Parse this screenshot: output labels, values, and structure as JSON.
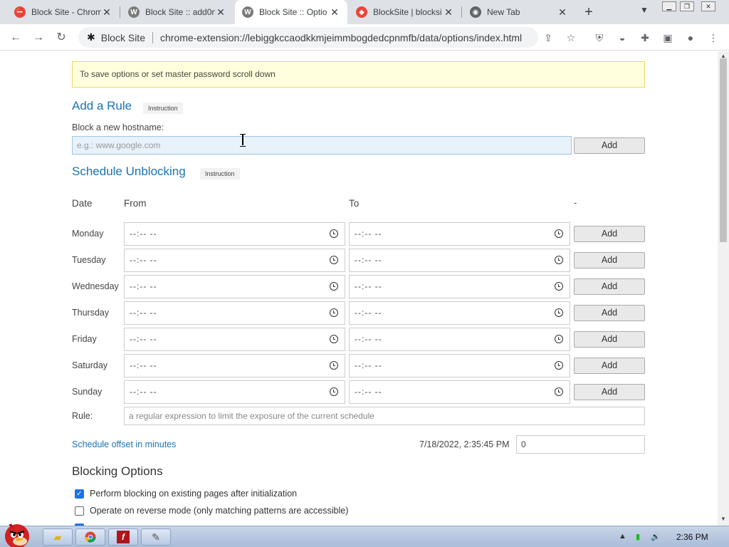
{
  "browser": {
    "tabs": [
      {
        "title": "Block Site - Chrom",
        "icon": "block-site-icon",
        "color": "#e8453c"
      },
      {
        "title": "Block Site :: add0n",
        "icon": "w-icon",
        "color": "#7b7b7b"
      },
      {
        "title": "Block Site :: Optio",
        "icon": "w-icon",
        "color": "#7b7b7b"
      },
      {
        "title": "BlockSite | blocksi",
        "icon": "shield-icon",
        "color": "#e8453c"
      },
      {
        "title": "New Tab",
        "icon": "chrome-icon",
        "color": "#5f6368"
      }
    ],
    "active_tab": 2,
    "new_tab_glyph": "+",
    "address": {
      "extension_name": "Block Site",
      "url": "chrome-extension://lebiggkccaodkkmjeimmbogdedcpnmfb/data/options/index.html"
    }
  },
  "notice": "To save options or set master password scroll down",
  "add_rule": {
    "title": "Add a Rule",
    "instruction": "Instruction",
    "hostname_label": "Block a new hostname:",
    "hostname_placeholder": "e.g.: www.google.com",
    "add_label": "Add"
  },
  "schedule": {
    "title": "Schedule Unblocking",
    "instruction": "Instruction",
    "headers": {
      "date": "Date",
      "from": "From",
      "to": "To",
      "dash": "-"
    },
    "time_placeholder": "--:-- --",
    "days": [
      {
        "name": "Monday",
        "add": "Add"
      },
      {
        "name": "Tuesday",
        "add": "Add"
      },
      {
        "name": "Wednesday",
        "add": "Add"
      },
      {
        "name": "Thursday",
        "add": "Add"
      },
      {
        "name": "Friday",
        "add": "Add"
      },
      {
        "name": "Saturday",
        "add": "Add"
      },
      {
        "name": "Sunday",
        "add": "Add"
      }
    ],
    "rule_label": "Rule:",
    "rule_placeholder": "a regular expression to limit the exposure of the current schedule",
    "offset_label": "Schedule offset in minutes",
    "timestamp": "7/18/2022, 2:35:45 PM",
    "offset_value": "0"
  },
  "blocking_options": {
    "title": "Blocking Options",
    "items": [
      {
        "label": "Perform blocking on existing pages after initialization",
        "checked": true
      },
      {
        "label": "Operate on reverse mode (only matching patterns are accessible)",
        "checked": false
      }
    ]
  },
  "taskbar": {
    "time": "2:36 PM"
  }
}
